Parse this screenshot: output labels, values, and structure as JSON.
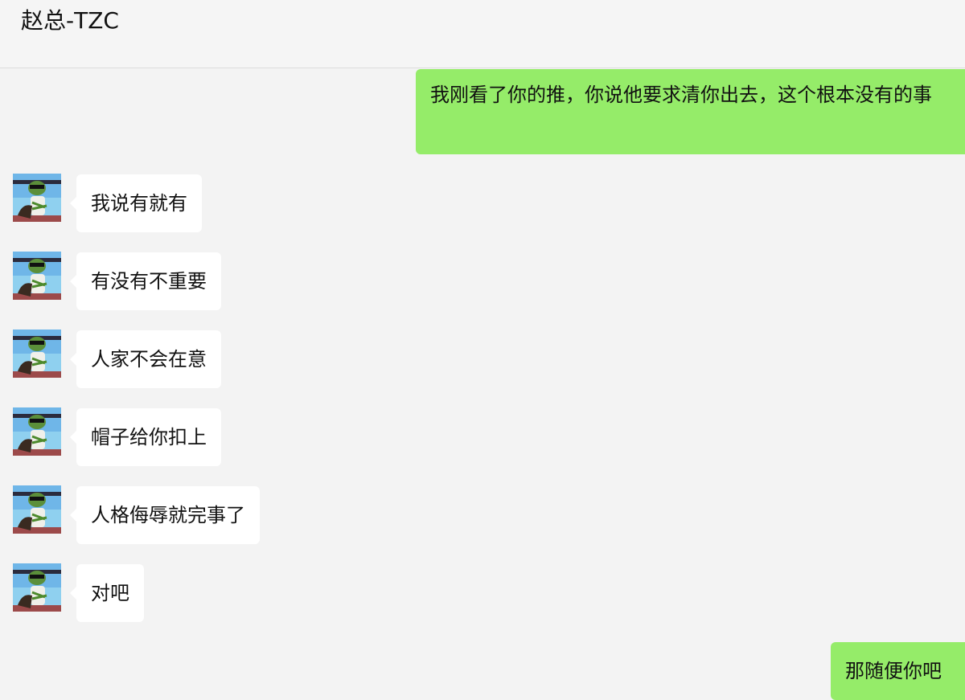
{
  "header": {
    "title": "赵总-TZC"
  },
  "messages": [
    {
      "direction": "out",
      "text": "我刚看了你的推，你说他要求清你出去，这个根本没有的事"
    },
    {
      "direction": "in",
      "text": "我说有就有"
    },
    {
      "direction": "in",
      "text": "有没有不重要"
    },
    {
      "direction": "in",
      "text": "人家不会在意"
    },
    {
      "direction": "in",
      "text": "帽子给你扣上"
    },
    {
      "direction": "in",
      "text": "人格侮辱就完事了"
    },
    {
      "direction": "in",
      "text": "对吧"
    },
    {
      "direction": "out",
      "text": "那随便你吧"
    }
  ],
  "avatar": {
    "icon": "frog-avatar-icon"
  },
  "colors": {
    "outgoing_bubble": "#95ec69",
    "incoming_bubble": "#ffffff",
    "background": "#f3f3f3"
  }
}
